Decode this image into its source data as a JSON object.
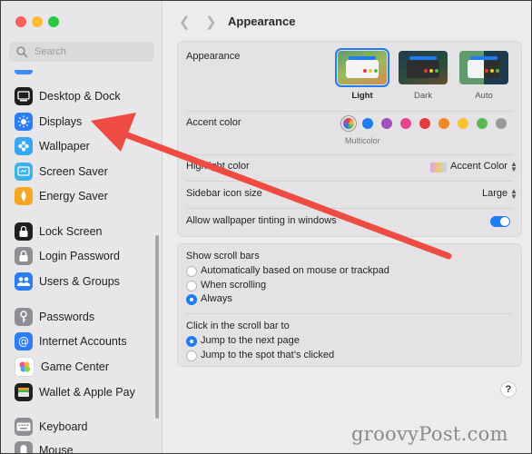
{
  "sidebar": {
    "search_placeholder": "Search",
    "items": [
      {
        "label": "Desktop & Dock",
        "icon": "desktop-dock-icon",
        "color": "#1f1f1f"
      },
      {
        "label": "Displays",
        "icon": "displays-icon",
        "color": "#2a7df4"
      },
      {
        "label": "Wallpaper",
        "icon": "wallpaper-icon",
        "color": "#36a7f0"
      },
      {
        "label": "Screen Saver",
        "icon": "screen-saver-icon",
        "color": "#3bb3e8"
      },
      {
        "label": "Energy Saver",
        "icon": "energy-saver-icon",
        "color": "#f5a623"
      },
      {
        "label": "Lock Screen",
        "icon": "lock-screen-icon",
        "color": "#1f1f1f"
      },
      {
        "label": "Login Password",
        "icon": "login-password-icon",
        "color": "#8e8e93"
      },
      {
        "label": "Users & Groups",
        "icon": "users-groups-icon",
        "color": "#2a7df4"
      },
      {
        "label": "Passwords",
        "icon": "passwords-icon",
        "color": "#8e8e93"
      },
      {
        "label": "Internet Accounts",
        "icon": "internet-accounts-icon",
        "color": "#2a7df4"
      },
      {
        "label": "Game Center",
        "icon": "game-center-icon",
        "color": "#ffffff"
      },
      {
        "label": "Wallet & Apple Pay",
        "icon": "wallet-icon",
        "color": "#1f1f1f"
      },
      {
        "label": "Keyboard",
        "icon": "keyboard-icon",
        "color": "#8e8e93"
      },
      {
        "label": "Mouse",
        "icon": "mouse-icon",
        "color": "#8e8e93"
      }
    ]
  },
  "header": {
    "title": "Appearance"
  },
  "appearance": {
    "label": "Appearance",
    "options": [
      "Light",
      "Dark",
      "Auto"
    ],
    "selected": "Light"
  },
  "accent": {
    "label": "Accent color",
    "multicolor_label": "Multicolor",
    "colors": [
      "#8e44ad",
      "#1f7cf2",
      "#a24fbd",
      "#e5478f",
      "#e23c3c",
      "#f08a24",
      "#f6c531",
      "#5ab94f",
      "#9a9a9a"
    ]
  },
  "highlight": {
    "label": "Highlight color",
    "value": "Accent Color"
  },
  "sidebar_icon_size": {
    "label": "Sidebar icon size",
    "value": "Large"
  },
  "tinting": {
    "label": "Allow wallpaper tinting in windows",
    "enabled": true
  },
  "scroll_bars": {
    "label": "Show scroll bars",
    "options": [
      "Automatically based on mouse or trackpad",
      "When scrolling",
      "Always"
    ],
    "selected": "Always"
  },
  "click_scroll": {
    "label": "Click in the scroll bar to",
    "options": [
      "Jump to the next page",
      "Jump to the spot that’s clicked"
    ],
    "selected": "Jump to the next page"
  },
  "help_label": "?",
  "watermark": "groovyPost.com",
  "colors": {
    "arrow": "#ee4b42",
    "accent": "#1f7cf2"
  }
}
